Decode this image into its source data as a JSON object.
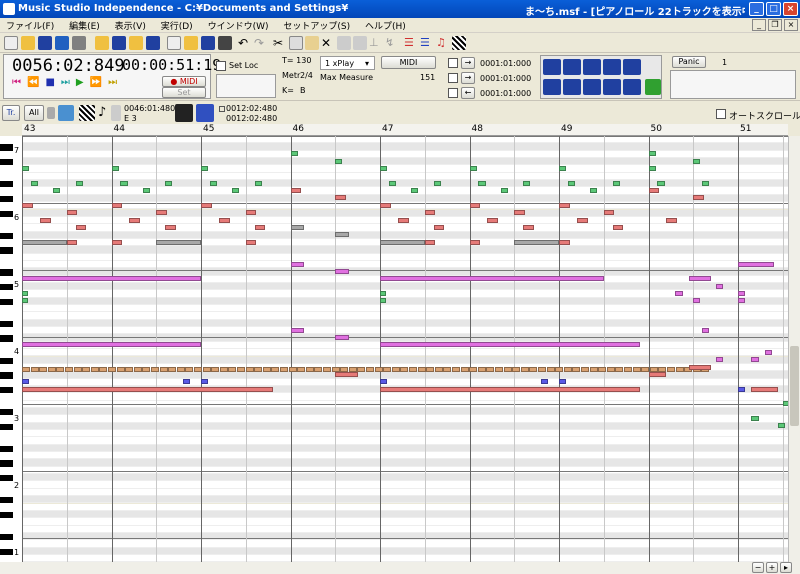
{
  "window": {
    "title_left": "Music Studio Independence - C:¥Documents and Settings¥",
    "title_right": "ま〜ち.msf - [ピアノロール 22トラックを表示中 (全トラ"
  },
  "menu": [
    "ファイル(F)",
    "編集(E)",
    "表示(V)",
    "実行(D)",
    "ウインドウ(W)",
    "セットアップ(S)",
    "ヘルプ(H)"
  ],
  "transport": {
    "position": "0056:02:849",
    "time": "00:00:51:19",
    "midi_label": "● MIDI",
    "set_label": "Set",
    "set_loc_label": "Set Loc",
    "tempo": "T= 130",
    "meter_label": "Metr",
    "meter": "2/4",
    "key_label": "K=",
    "key": "B",
    "play_mode": "1 xPlay",
    "midi_button": "MIDI",
    "max_measure_label": "Max Measure",
    "max_measure": "151",
    "loc1": "0001:01:000",
    "loc2": "0001:01:000",
    "loc3": "0001:01:000",
    "panic": "Panic",
    "panic_value": "1"
  },
  "subbar": {
    "track": "Tr.",
    "all": "All",
    "pos1": "0046:01:480",
    "pitch": "E 3",
    "pos2": "0012:02:480",
    "pos3": "0012:02:480",
    "autoscroll": "オートスクロール"
  },
  "ruler": [
    "43",
    "44",
    "45",
    "46",
    "47",
    "48",
    "49",
    "50",
    "51"
  ],
  "octaves": [
    "7",
    "6",
    "5",
    "4",
    "3",
    "2",
    "1"
  ],
  "colors": {
    "green": "#5cc878",
    "red": "#e67a78",
    "gray": "#a8a8a8",
    "magenta": "#e070e0",
    "blue": "#5a5ae6",
    "orange": "#d8a070",
    "title_blue": "#0a5fd8"
  },
  "notes": [
    {
      "c": "green",
      "b": 46,
      "s": 0,
      "len": 0.08,
      "r": 1
    },
    {
      "c": "green",
      "b": 46.5,
      "s": 0,
      "len": 0.08,
      "r": 2
    },
    {
      "c": "green",
      "b": 47,
      "s": 0,
      "len": 0.08,
      "r": 3
    },
    {
      "c": "green",
      "b": 50,
      "s": 0,
      "len": 0.08,
      "r": 1
    },
    {
      "c": "green",
      "b": 50.5,
      "s": 0,
      "len": 0.08,
      "r": 2
    },
    {
      "c": "green",
      "b": 43,
      "s": 0,
      "len": 0.08,
      "r": 3
    },
    {
      "c": "green",
      "b": 44,
      "s": 0,
      "len": 0.08,
      "r": 3
    },
    {
      "c": "green",
      "b": 45,
      "s": 0,
      "len": 0.08,
      "r": 3
    },
    {
      "c": "green",
      "b": 48,
      "s": 0,
      "len": 0.08,
      "r": 3
    },
    {
      "c": "green",
      "b": 49,
      "s": 0,
      "len": 0.08,
      "r": 3
    },
    {
      "c": "green",
      "b": 50,
      "s": 0,
      "len": 0.08,
      "r": 3
    },
    {
      "c": "green",
      "b": 43.1,
      "s": 0,
      "len": 0.08,
      "r": 5
    },
    {
      "c": "green",
      "b": 43.6,
      "s": 0,
      "len": 0.08,
      "r": 5
    },
    {
      "c": "green",
      "b": 44.1,
      "s": 0,
      "len": 0.08,
      "r": 5
    },
    {
      "c": "green",
      "b": 44.6,
      "s": 0,
      "len": 0.08,
      "r": 5
    },
    {
      "c": "green",
      "b": 45.1,
      "s": 0,
      "len": 0.08,
      "r": 5
    },
    {
      "c": "green",
      "b": 45.6,
      "s": 0,
      "len": 0.08,
      "r": 5
    },
    {
      "c": "green",
      "b": 47.1,
      "s": 0,
      "len": 0.08,
      "r": 5
    },
    {
      "c": "green",
      "b": 47.6,
      "s": 0,
      "len": 0.08,
      "r": 5
    },
    {
      "c": "green",
      "b": 48.1,
      "s": 0,
      "len": 0.08,
      "r": 5
    },
    {
      "c": "green",
      "b": 48.6,
      "s": 0,
      "len": 0.08,
      "r": 5
    },
    {
      "c": "green",
      "b": 49.1,
      "s": 0,
      "len": 0.08,
      "r": 5
    },
    {
      "c": "green",
      "b": 49.6,
      "s": 0,
      "len": 0.08,
      "r": 5
    },
    {
      "c": "green",
      "b": 50.1,
      "s": 0,
      "len": 0.08,
      "r": 5
    },
    {
      "c": "green",
      "b": 50.6,
      "s": 0,
      "len": 0.08,
      "r": 5
    },
    {
      "c": "green",
      "b": 43.35,
      "s": 0,
      "len": 0.08,
      "r": 6
    },
    {
      "c": "green",
      "b": 44.35,
      "s": 0,
      "len": 0.08,
      "r": 6
    },
    {
      "c": "green",
      "b": 45.35,
      "s": 0,
      "len": 0.08,
      "r": 6
    },
    {
      "c": "green",
      "b": 47.35,
      "s": 0,
      "len": 0.08,
      "r": 6
    },
    {
      "c": "green",
      "b": 48.35,
      "s": 0,
      "len": 0.08,
      "r": 6
    },
    {
      "c": "green",
      "b": 49.35,
      "s": 0,
      "len": 0.08,
      "r": 6
    },
    {
      "c": "red",
      "b": 46,
      "s": 0,
      "len": 0.12,
      "r": 6
    },
    {
      "c": "red",
      "b": 46.5,
      "s": 0,
      "len": 0.12,
      "r": 7
    },
    {
      "c": "red",
      "b": 50,
      "s": 0,
      "len": 0.12,
      "r": 6
    },
    {
      "c": "red",
      "b": 50.5,
      "s": 0,
      "len": 0.12,
      "r": 7
    },
    {
      "c": "red",
      "b": 43,
      "s": 0,
      "len": 0.12,
      "r": 8
    },
    {
      "c": "red",
      "b": 44,
      "s": 0,
      "len": 0.12,
      "r": 8
    },
    {
      "c": "red",
      "b": 45,
      "s": 0,
      "len": 0.12,
      "r": 8
    },
    {
      "c": "red",
      "b": 47,
      "s": 0,
      "len": 0.12,
      "r": 8
    },
    {
      "c": "red",
      "b": 48,
      "s": 0,
      "len": 0.12,
      "r": 8
    },
    {
      "c": "red",
      "b": 49,
      "s": 0,
      "len": 0.12,
      "r": 8
    },
    {
      "c": "red",
      "b": 43.5,
      "s": 0,
      "len": 0.12,
      "r": 9
    },
    {
      "c": "red",
      "b": 44.5,
      "s": 0,
      "len": 0.12,
      "r": 9
    },
    {
      "c": "red",
      "b": 45.5,
      "s": 0,
      "len": 0.12,
      "r": 9
    },
    {
      "c": "red",
      "b": 47.5,
      "s": 0,
      "len": 0.12,
      "r": 9
    },
    {
      "c": "red",
      "b": 48.5,
      "s": 0,
      "len": 0.12,
      "r": 9
    },
    {
      "c": "red",
      "b": 49.5,
      "s": 0,
      "len": 0.12,
      "r": 9
    },
    {
      "c": "red",
      "b": 43.2,
      "s": 0,
      "len": 0.12,
      "r": 10
    },
    {
      "c": "red",
      "b": 44.2,
      "s": 0,
      "len": 0.12,
      "r": 10
    },
    {
      "c": "red",
      "b": 45.2,
      "s": 0,
      "len": 0.12,
      "r": 10
    },
    {
      "c": "red",
      "b": 47.2,
      "s": 0,
      "len": 0.12,
      "r": 10
    },
    {
      "c": "red",
      "b": 48.2,
      "s": 0,
      "len": 0.12,
      "r": 10
    },
    {
      "c": "red",
      "b": 49.2,
      "s": 0,
      "len": 0.12,
      "r": 10
    },
    {
      "c": "red",
      "b": 50.2,
      "s": 0,
      "len": 0.12,
      "r": 10
    },
    {
      "c": "red",
      "b": 43.6,
      "s": 0,
      "len": 0.12,
      "r": 11
    },
    {
      "c": "red",
      "b": 44.6,
      "s": 0,
      "len": 0.12,
      "r": 11
    },
    {
      "c": "red",
      "b": 45.6,
      "s": 0,
      "len": 0.12,
      "r": 11
    },
    {
      "c": "red",
      "b": 47.6,
      "s": 0,
      "len": 0.12,
      "r": 11
    },
    {
      "c": "red",
      "b": 48.6,
      "s": 0,
      "len": 0.12,
      "r": 11
    },
    {
      "c": "red",
      "b": 49.6,
      "s": 0,
      "len": 0.12,
      "r": 11
    },
    {
      "c": "gray",
      "b": 46,
      "s": 0,
      "len": 0.15,
      "r": 11
    },
    {
      "c": "gray",
      "b": 46.5,
      "s": 0,
      "len": 0.15,
      "r": 12
    },
    {
      "c": "gray",
      "b": 43,
      "s": 0,
      "len": 0.5,
      "r": 13
    },
    {
      "c": "gray",
      "b": 44.5,
      "s": 0,
      "len": 0.5,
      "r": 13
    },
    {
      "c": "gray",
      "b": 47,
      "s": 0,
      "len": 0.5,
      "r": 13
    },
    {
      "c": "gray",
      "b": 48.5,
      "s": 0,
      "len": 0.5,
      "r": 13
    },
    {
      "c": "red",
      "b": 43.5,
      "s": 0,
      "len": 0.12,
      "r": 13
    },
    {
      "c": "red",
      "b": 44,
      "s": 0,
      "len": 0.12,
      "r": 13
    },
    {
      "c": "red",
      "b": 45.5,
      "s": 0,
      "len": 0.12,
      "r": 13
    },
    {
      "c": "red",
      "b": 47.5,
      "s": 0,
      "len": 0.12,
      "r": 13
    },
    {
      "c": "red",
      "b": 48,
      "s": 0,
      "len": 0.12,
      "r": 13
    },
    {
      "c": "red",
      "b": 49,
      "s": 0,
      "len": 0.12,
      "r": 13
    },
    {
      "c": "magenta",
      "b": 46,
      "s": 0,
      "len": 0.15,
      "r": 16
    },
    {
      "c": "magenta",
      "b": 46.5,
      "s": 0,
      "len": 0.15,
      "r": 17
    },
    {
      "c": "magenta",
      "b": 43,
      "s": 0,
      "len": 2,
      "r": 18
    },
    {
      "c": "magenta",
      "b": 47,
      "s": 0,
      "len": 2.5,
      "r": 18
    },
    {
      "c": "magenta",
      "b": 50.45,
      "s": 0,
      "len": 0.25,
      "r": 18
    },
    {
      "c": "magenta",
      "b": 51,
      "s": 0,
      "len": 0.4,
      "r": 16
    },
    {
      "c": "magenta",
      "b": 50.75,
      "s": 0,
      "len": 0.08,
      "r": 19
    },
    {
      "c": "green",
      "b": 43,
      "s": 0,
      "len": 0.06,
      "r": 20
    },
    {
      "c": "green",
      "b": 43,
      "s": 0,
      "len": 0.06,
      "r": 21
    },
    {
      "c": "green",
      "b": 47,
      "s": 0,
      "len": 0.06,
      "r": 20
    },
    {
      "c": "green",
      "b": 47,
      "s": 0,
      "len": 0.06,
      "r": 21
    },
    {
      "c": "magenta",
      "b": 50.3,
      "s": 0,
      "len": 0.08,
      "r": 20
    },
    {
      "c": "magenta",
      "b": 50.5,
      "s": 0,
      "len": 0.08,
      "r": 21
    },
    {
      "c": "magenta",
      "b": 51,
      "s": 0,
      "len": 0.08,
      "r": 20
    },
    {
      "c": "magenta",
      "b": 51,
      "s": 0,
      "len": 0.08,
      "r": 21
    },
    {
      "c": "magenta",
      "b": 46,
      "s": 0,
      "len": 0.15,
      "r": 25
    },
    {
      "c": "magenta",
      "b": 46.5,
      "s": 0,
      "len": 0.15,
      "r": 26
    },
    {
      "c": "magenta",
      "b": 43,
      "s": 0,
      "len": 2,
      "r": 27
    },
    {
      "c": "magenta",
      "b": 47,
      "s": 0,
      "len": 2.9,
      "r": 27
    },
    {
      "c": "magenta",
      "b": 50.6,
      "s": 0,
      "len": 0.08,
      "r": 25
    },
    {
      "c": "magenta",
      "b": 50.75,
      "s": 0,
      "len": 0.08,
      "r": 29
    },
    {
      "c": "magenta",
      "b": 51.3,
      "s": 0,
      "len": 0.08,
      "r": 28
    },
    {
      "c": "magenta",
      "b": 51.15,
      "s": 0,
      "len": 0.08,
      "r": 29
    },
    {
      "c": "red",
      "b": 50.45,
      "s": 0,
      "len": 0.25,
      "r": 30
    },
    {
      "c": "red",
      "b": 46.5,
      "s": 0,
      "len": 0.25,
      "r": 31
    },
    {
      "c": "red",
      "b": 50,
      "s": 0,
      "len": 0.2,
      "r": 31
    },
    {
      "c": "blue",
      "b": 43,
      "s": 0,
      "len": 0.08,
      "r": 32
    },
    {
      "c": "blue",
      "b": 44.8,
      "s": 0,
      "len": 0.08,
      "r": 32
    },
    {
      "c": "blue",
      "b": 45,
      "s": 0,
      "len": 0.08,
      "r": 32
    },
    {
      "c": "blue",
      "b": 47,
      "s": 0,
      "len": 0.08,
      "r": 32
    },
    {
      "c": "blue",
      "b": 48.8,
      "s": 0,
      "len": 0.08,
      "r": 32
    },
    {
      "c": "blue",
      "b": 49,
      "s": 0,
      "len": 0.08,
      "r": 32
    },
    {
      "c": "blue",
      "b": 51,
      "s": 0,
      "len": 0.08,
      "r": 33
    },
    {
      "c": "blue",
      "b": 51.3,
      "s": 0,
      "len": 0.08,
      "r": 33
    },
    {
      "c": "red",
      "b": 43,
      "s": 0,
      "len": 2.8,
      "r": 33
    },
    {
      "c": "red",
      "b": 47,
      "s": 0,
      "len": 2.9,
      "r": 33
    },
    {
      "c": "red",
      "b": 51.15,
      "s": 0,
      "len": 0.3,
      "r": 33
    },
    {
      "c": "green",
      "b": 51.15,
      "s": 0,
      "len": 0.08,
      "r": 37
    },
    {
      "c": "green",
      "b": 51.5,
      "s": 0,
      "len": 0.08,
      "r": 35
    },
    {
      "c": "green",
      "b": 51.45,
      "s": 0,
      "len": 0.08,
      "r": 38
    }
  ]
}
